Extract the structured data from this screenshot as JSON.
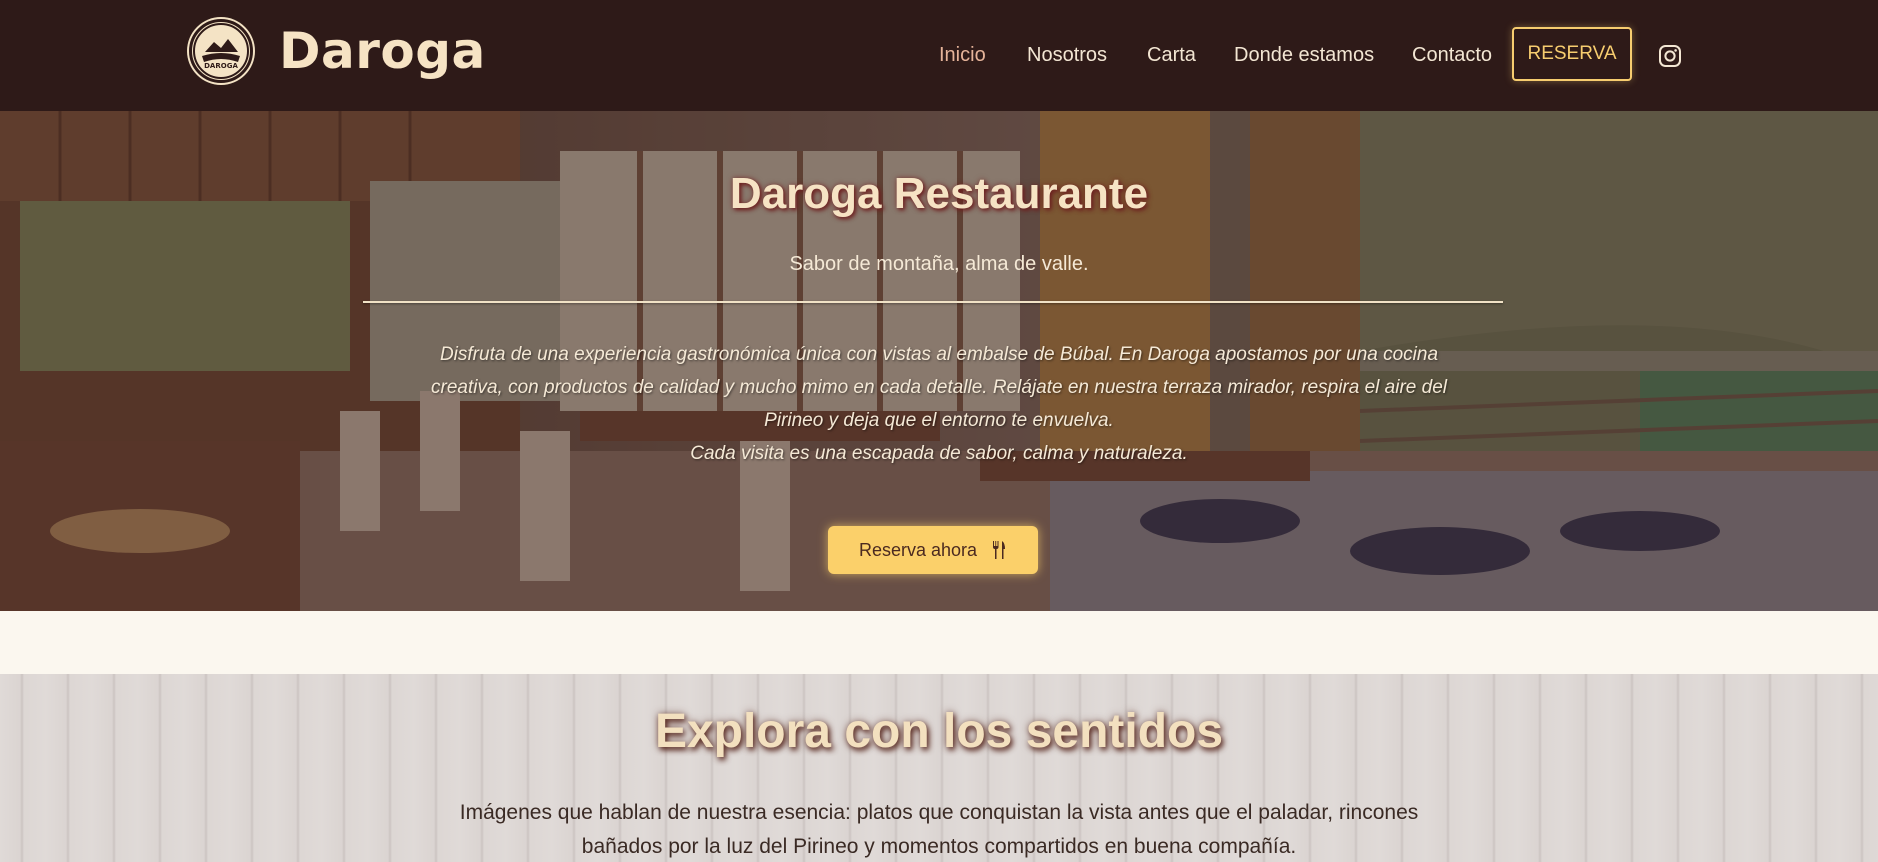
{
  "brand": {
    "name": "Daroga",
    "logo_text": "DAROGA"
  },
  "nav": {
    "items": [
      {
        "label": "Inicio",
        "active": true
      },
      {
        "label": "Nosotros"
      },
      {
        "label": "Carta"
      },
      {
        "label": "Donde estamos"
      },
      {
        "label": "Contacto"
      }
    ],
    "reserva_label": "RESERVA",
    "instagram_icon": "instagram-icon"
  },
  "hero": {
    "title": "Daroga Restaurante",
    "subtitle": "Sabor de montaña, alma de valle.",
    "description_lines": [
      "Disfruta de una experiencia gastronómica única con vistas al embalse de Búbal. En Daroga apostamos por una cocina",
      "creativa, con productos de calidad y mucho mimo en cada detalle. Relájate en nuestra terraza mirador, respira el aire del",
      "Pirineo y deja que el entorno te envuelva.",
      "Cada visita es una escapada de sabor, calma y naturaleza."
    ],
    "cta_label": "Reserva ahora",
    "cta_icon": "fork-knife-icon"
  },
  "explore": {
    "title": "Explora con los sentidos",
    "description_lines": [
      "Imágenes que hablan de nuestra esencia: platos que conquistan la vista antes que el paladar, rincones",
      "bañados por la luz del Pirineo y momentos compartidos en buena compañía."
    ]
  },
  "colors": {
    "navbar_bg": "#2e1a18",
    "brand_cream": "#f6e3c4",
    "accent_gold": "#f7cd6f",
    "cta_yellow": "#fbd06a",
    "active_link": "#e6b49a"
  }
}
